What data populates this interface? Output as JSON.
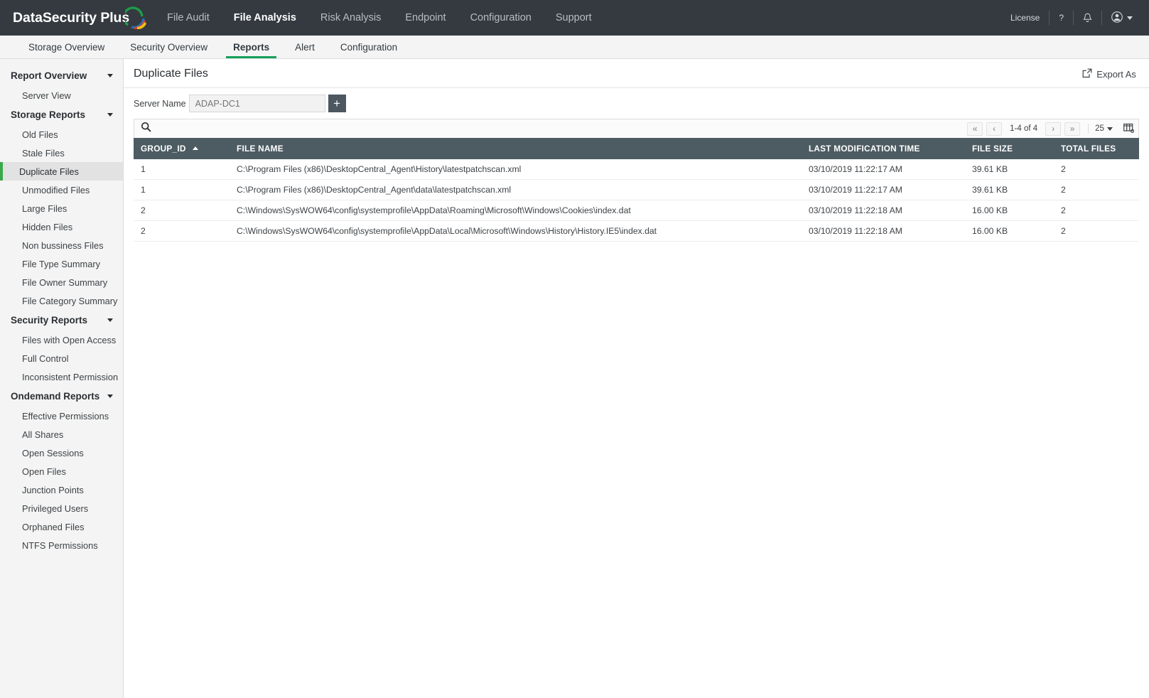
{
  "topbar": {
    "brand": "DataSecurity Plus",
    "brand_mark_icon": "swoosh-logo-icon",
    "nav": [
      {
        "label": "File Audit",
        "active": false
      },
      {
        "label": "File Analysis",
        "active": true
      },
      {
        "label": "Risk Analysis",
        "active": false
      },
      {
        "label": "Endpoint",
        "active": false
      },
      {
        "label": "Configuration",
        "active": false
      },
      {
        "label": "Support",
        "active": false
      }
    ],
    "license_label": "License",
    "help_label": "?",
    "bell_icon": "bell-icon",
    "avatar_icon": "user-avatar-icon",
    "caret_icon": "chevron-down-icon"
  },
  "subnav": [
    {
      "label": "Storage Overview",
      "active": false
    },
    {
      "label": "Security Overview",
      "active": false
    },
    {
      "label": "Reports",
      "active": true
    },
    {
      "label": "Alert",
      "active": false
    },
    {
      "label": "Configuration",
      "active": false
    }
  ],
  "sidebar": {
    "groups": [
      {
        "title": "Report Overview",
        "items": [
          {
            "label": "Server View",
            "active": false
          }
        ]
      },
      {
        "title": "Storage Reports",
        "items": [
          {
            "label": "Old Files",
            "active": false
          },
          {
            "label": "Stale Files",
            "active": false
          },
          {
            "label": "Duplicate Files",
            "active": true
          },
          {
            "label": "Unmodified Files",
            "active": false
          },
          {
            "label": "Large Files",
            "active": false
          },
          {
            "label": "Hidden Files",
            "active": false
          },
          {
            "label": "Non bussiness Files",
            "active": false
          },
          {
            "label": "File Type Summary",
            "active": false
          },
          {
            "label": "File Owner Summary",
            "active": false
          },
          {
            "label": "File Category Summary",
            "active": false
          }
        ]
      },
      {
        "title": "Security Reports",
        "items": [
          {
            "label": "Files with Open Access",
            "active": false
          },
          {
            "label": "Full Control",
            "active": false
          },
          {
            "label": "Inconsistent Permission",
            "active": false
          }
        ]
      },
      {
        "title": "Ondemand Reports",
        "items": [
          {
            "label": "Effective Permissions",
            "active": false
          },
          {
            "label": "All Shares",
            "active": false
          },
          {
            "label": "Open Sessions",
            "active": false
          },
          {
            "label": "Open Files",
            "active": false
          },
          {
            "label": "Junction Points",
            "active": false
          },
          {
            "label": "Privileged Users",
            "active": false
          },
          {
            "label": "Orphaned Files",
            "active": false
          },
          {
            "label": "NTFS Permissions",
            "active": false
          }
        ]
      }
    ]
  },
  "page": {
    "title": "Duplicate Files",
    "export_label": "Export As",
    "export_icon": "external-link-icon",
    "server_name_label": "Server Name",
    "server_name_value": "ADAP-DC1",
    "server_name_placeholder": "ADAP-DC1",
    "add_button_label": "+"
  },
  "toolbar": {
    "search_icon": "search-icon",
    "first_page_label": "«",
    "prev_page_label": "‹",
    "page_count": "1-4 of 4",
    "next_page_label": "›",
    "last_page_label": "»",
    "page_size": "25",
    "page_size_caret": "chevron-down-icon",
    "column-settings_icon": "table-columns-icon"
  },
  "table": {
    "columns": [
      {
        "label": "GROUP_ID",
        "sort": "asc"
      },
      {
        "label": "FILE NAME",
        "sort": ""
      },
      {
        "label": "LAST MODIFICATION TIME",
        "sort": ""
      },
      {
        "label": "FILE SIZE",
        "sort": ""
      },
      {
        "label": "TOTAL FILES",
        "sort": ""
      }
    ],
    "rows": [
      {
        "group_id": "1",
        "file_name": "C:\\Program Files (x86)\\DesktopCentral_Agent\\History\\latestpatchscan.xml",
        "last_modification_time": "03/10/2019 11:22:17 AM",
        "file_size": "39.61 KB",
        "total_files": "2"
      },
      {
        "group_id": "1",
        "file_name": "C:\\Program Files (x86)\\DesktopCentral_Agent\\data\\latestpatchscan.xml",
        "last_modification_time": "03/10/2019 11:22:17 AM",
        "file_size": "39.61 KB",
        "total_files": "2"
      },
      {
        "group_id": "2",
        "file_name": "C:\\Windows\\SysWOW64\\config\\systemprofile\\AppData\\Roaming\\Microsoft\\Windows\\Cookies\\index.dat",
        "last_modification_time": "03/10/2019 11:22:18 AM",
        "file_size": "16.00 KB",
        "total_files": "2"
      },
      {
        "group_id": "2",
        "file_name": "C:\\Windows\\SysWOW64\\config\\systemprofile\\AppData\\Local\\Microsoft\\Windows\\History\\History.IE5\\index.dat",
        "last_modification_time": "03/10/2019 11:22:18 AM",
        "file_size": "16.00 KB",
        "total_files": "2"
      }
    ]
  },
  "colors": {
    "topbar_bg": "#343a40",
    "accent_green": "#17a05a",
    "table_header_bg": "#4d5c63",
    "sidebar_bg": "#f4f4f4",
    "active_item_bg": "#e2e2e2"
  }
}
